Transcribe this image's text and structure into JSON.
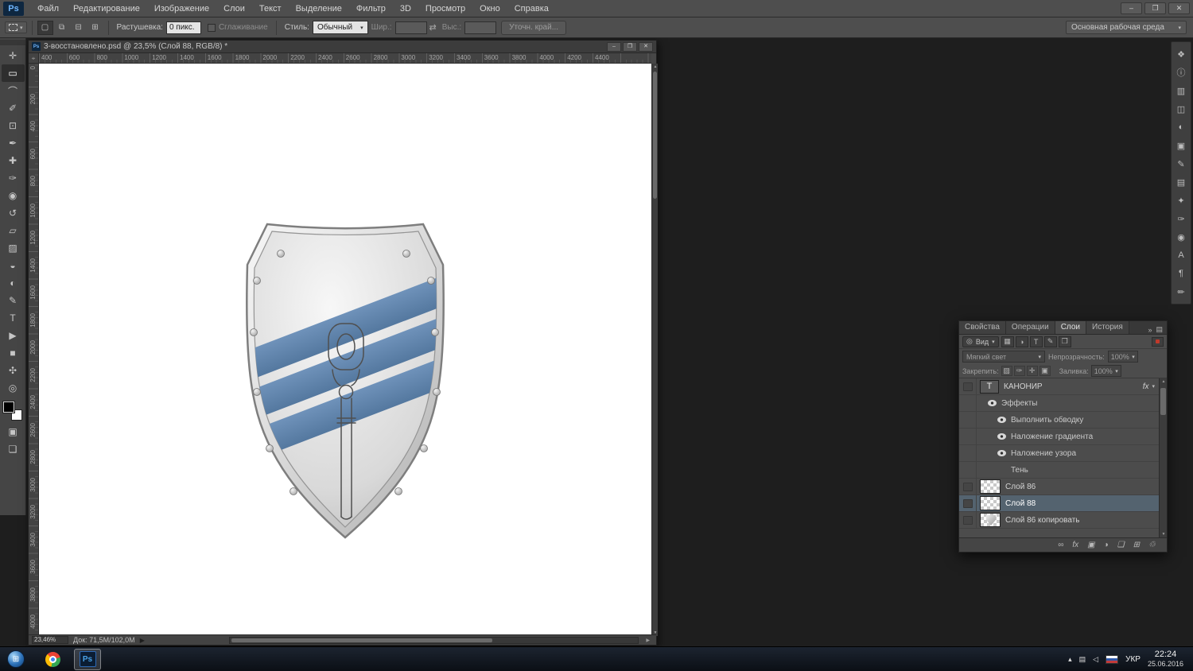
{
  "icons": {
    "caret_down": "▾",
    "double_arrow": "»",
    "swap": "⇄",
    "triangle_right": "▶",
    "target": "⌖",
    "search": "◎",
    "menu_lines": "▤"
  },
  "menu": {
    "logo_text": "Ps",
    "items": [
      "Файл",
      "Редактирование",
      "Изображение",
      "Слои",
      "Текст",
      "Выделение",
      "Фильтр",
      "3D",
      "Просмотр",
      "Окно",
      "Справка"
    ]
  },
  "window_controls": {
    "minimize": "–",
    "restore": "❐",
    "close": "✕"
  },
  "options": {
    "selection_modes": [
      {
        "name": "new-selection-icon",
        "glyph": "▢"
      },
      {
        "name": "add-to-selection-icon",
        "glyph": "⧉"
      },
      {
        "name": "subtract-from-selection-icon",
        "glyph": "⊟"
      },
      {
        "name": "intersect-selection-icon",
        "glyph": "⊞"
      }
    ],
    "feather_label": "Растушевка:",
    "feather_value": "0 пикс.",
    "antialias_label": "Сглаживание",
    "style_label": "Стиль:",
    "style_value": "Обычный",
    "width_label": "Шир.:",
    "width_value": "",
    "height_label": "Выс.:",
    "height_value": "",
    "refine_edge_label": "Уточн. край...",
    "workspace_value": "Основная рабочая среда"
  },
  "toolbar": {
    "tools": [
      {
        "name": "move-tool",
        "glyph": "✛"
      },
      {
        "name": "rectangular-marquee-tool",
        "glyph": "▭",
        "selected": true
      },
      {
        "name": "lasso-tool",
        "glyph": "⌒"
      },
      {
        "name": "quick-selection-tool",
        "glyph": "✐"
      },
      {
        "name": "crop-tool",
        "glyph": "⊡"
      },
      {
        "name": "eyedropper-tool",
        "glyph": "✒"
      },
      {
        "name": "healing-brush-tool",
        "glyph": "✚"
      },
      {
        "name": "brush-tool",
        "glyph": "✑"
      },
      {
        "name": "clone-stamp-tool",
        "glyph": "◉"
      },
      {
        "name": "history-brush-tool",
        "glyph": "↺"
      },
      {
        "name": "eraser-tool",
        "glyph": "▱"
      },
      {
        "name": "gradient-tool",
        "glyph": "▨"
      },
      {
        "name": "blur-tool",
        "glyph": "◒"
      },
      {
        "name": "dodge-tool",
        "glyph": "◐"
      },
      {
        "name": "pen-tool",
        "glyph": "✎"
      },
      {
        "name": "type-tool",
        "glyph": "T"
      },
      {
        "name": "path-selection-tool",
        "glyph": "▶"
      },
      {
        "name": "shape-tool",
        "glyph": "■"
      },
      {
        "name": "hand-tool",
        "glyph": "✣"
      },
      {
        "name": "zoom-tool",
        "glyph": "◎"
      }
    ],
    "extra_tools": [
      {
        "name": "quick-mask-icon",
        "glyph": "▣"
      },
      {
        "name": "screen-mode-icon",
        "glyph": "❏"
      }
    ]
  },
  "document": {
    "title": "3-восстановлено.psd @ 23,5% (Слой 88, RGB/8) *",
    "zoom": "23,46%",
    "doc_size": "Док: 71,5M/102,0M",
    "ruler_top": [
      "400",
      "600",
      "800",
      "1000",
      "1200",
      "1400",
      "1600",
      "1800",
      "2000",
      "2200",
      "2400",
      "2600",
      "2800",
      "3000",
      "3200",
      "3400",
      "3600",
      "3800",
      "4000",
      "4200",
      "4400"
    ],
    "ruler_left": [
      "0",
      "200",
      "400",
      "600",
      "800",
      "1000",
      "1200",
      "1400",
      "1600",
      "1800",
      "2000",
      "2200",
      "2400",
      "2600",
      "2800",
      "3000",
      "3200",
      "3400",
      "3600",
      "3800",
      "4000"
    ]
  },
  "layers_panel": {
    "tabs": [
      {
        "name": "tab-properties",
        "label": "Свойства",
        "active": false
      },
      {
        "name": "tab-actions",
        "label": "Операции",
        "active": false
      },
      {
        "name": "tab-layers",
        "label": "Слои",
        "active": true
      },
      {
        "name": "tab-history",
        "label": "История",
        "active": false
      }
    ],
    "filter_label": "Вид",
    "filter_icons": [
      {
        "name": "filter-pixel-layers-icon",
        "glyph": "▦"
      },
      {
        "name": "filter-adjustment-layers-icon",
        "glyph": "◑"
      },
      {
        "name": "filter-type-layers-icon",
        "glyph": "T"
      },
      {
        "name": "filter-shape-layers-icon",
        "glyph": "✎"
      },
      {
        "name": "filter-smart-objects-icon",
        "glyph": "❒"
      }
    ],
    "blend_mode": "Мягкий свет",
    "opacity_label": "Непрозрачность:",
    "opacity_value": "100%",
    "lock_label": "Закрепить:",
    "lock_icons": [
      {
        "name": "lock-transparency-icon",
        "glyph": "▨"
      },
      {
        "name": "lock-pixels-icon",
        "glyph": "✑"
      },
      {
        "name": "lock-position-icon",
        "glyph": "✛"
      },
      {
        "name": "lock-all-icon",
        "glyph": "▣"
      }
    ],
    "fill_label": "Заливка:",
    "fill_value": "100%",
    "layers": [
      {
        "name": "КАНОНИР",
        "kind": "text",
        "eye": false,
        "fx": true,
        "selected": false
      },
      {
        "name": "Эффекты",
        "kind": "effects",
        "eye": true
      },
      {
        "name": "Выполнить обводку",
        "kind": "effect",
        "eye": true
      },
      {
        "name": "Наложение градиента",
        "kind": "effect",
        "eye": true
      },
      {
        "name": "Наложение узора",
        "kind": "effect",
        "eye": true
      },
      {
        "name": "Тень",
        "kind": "effect",
        "eye": false
      },
      {
        "name": "Слой 86",
        "kind": "pixel",
        "eye": false,
        "thumb": "checker",
        "selected": false
      },
      {
        "name": "Слой 88",
        "kind": "pixel",
        "eye": false,
        "thumb": "checker",
        "selected": true
      },
      {
        "name": "Слой 86 копировать",
        "kind": "pixel",
        "eye": false,
        "thumb": "shield",
        "selected": false
      }
    ],
    "bottom_icons": [
      {
        "name": "link-layers-icon",
        "glyph": "∞"
      },
      {
        "name": "layer-styles-icon",
        "glyph": "fx"
      },
      {
        "name": "add-mask-icon",
        "glyph": "▣"
      },
      {
        "name": "adjustment-layer-icon",
        "glyph": "◑"
      },
      {
        "name": "new-group-icon",
        "glyph": "❏"
      },
      {
        "name": "new-layer-icon",
        "glyph": "⊞"
      },
      {
        "name": "delete-layer-icon",
        "glyph": "♲"
      }
    ]
  },
  "right_strip": [
    {
      "name": "color-panel-icon",
      "glyph": "❖"
    },
    {
      "name": "info-panel-icon",
      "glyph": "ⓘ"
    },
    {
      "name": "histogram-panel-icon",
      "glyph": "▥"
    },
    {
      "name": "navigator-panel-icon",
      "glyph": "◫"
    },
    {
      "name": "adjustments-panel-icon",
      "glyph": "◐"
    },
    {
      "name": "masks-panel-icon",
      "glyph": "▣"
    },
    {
      "name": "paths-panel-icon",
      "glyph": "✎"
    },
    {
      "name": "channels-panel-icon",
      "glyph": "▤"
    },
    {
      "name": "styles-panel-icon",
      "glyph": "✦"
    },
    {
      "name": "brush-panel-icon",
      "glyph": "✑"
    },
    {
      "name": "clone-source-panel-icon",
      "glyph": "◉"
    },
    {
      "name": "character-panel-icon",
      "glyph": "А"
    },
    {
      "name": "paragraph-panel-icon",
      "glyph": "¶"
    },
    {
      "name": "notes-panel-icon",
      "glyph": "✏"
    }
  ],
  "taskbar": {
    "language": "УКР",
    "time": "22:24",
    "date": "25.06.2016",
    "tray_icons": [
      {
        "name": "hidden-icons-arrow",
        "glyph": "▴"
      },
      {
        "name": "display-tray-icon",
        "glyph": "▤"
      },
      {
        "name": "volume-tray-icon",
        "glyph": "◁"
      }
    ]
  },
  "shield": {
    "canvas_color": "#ffffff",
    "silver_light": "#f7f7f7",
    "silver_mid": "#d9d9d9",
    "silver_dark": "#b3b3b3",
    "stripe_light": "#6f92ba",
    "stripe_dark": "#54789f",
    "border_color": "#7e7e7e",
    "inner_border_color": "#949494",
    "emblem_color": "#4f4f4f"
  }
}
